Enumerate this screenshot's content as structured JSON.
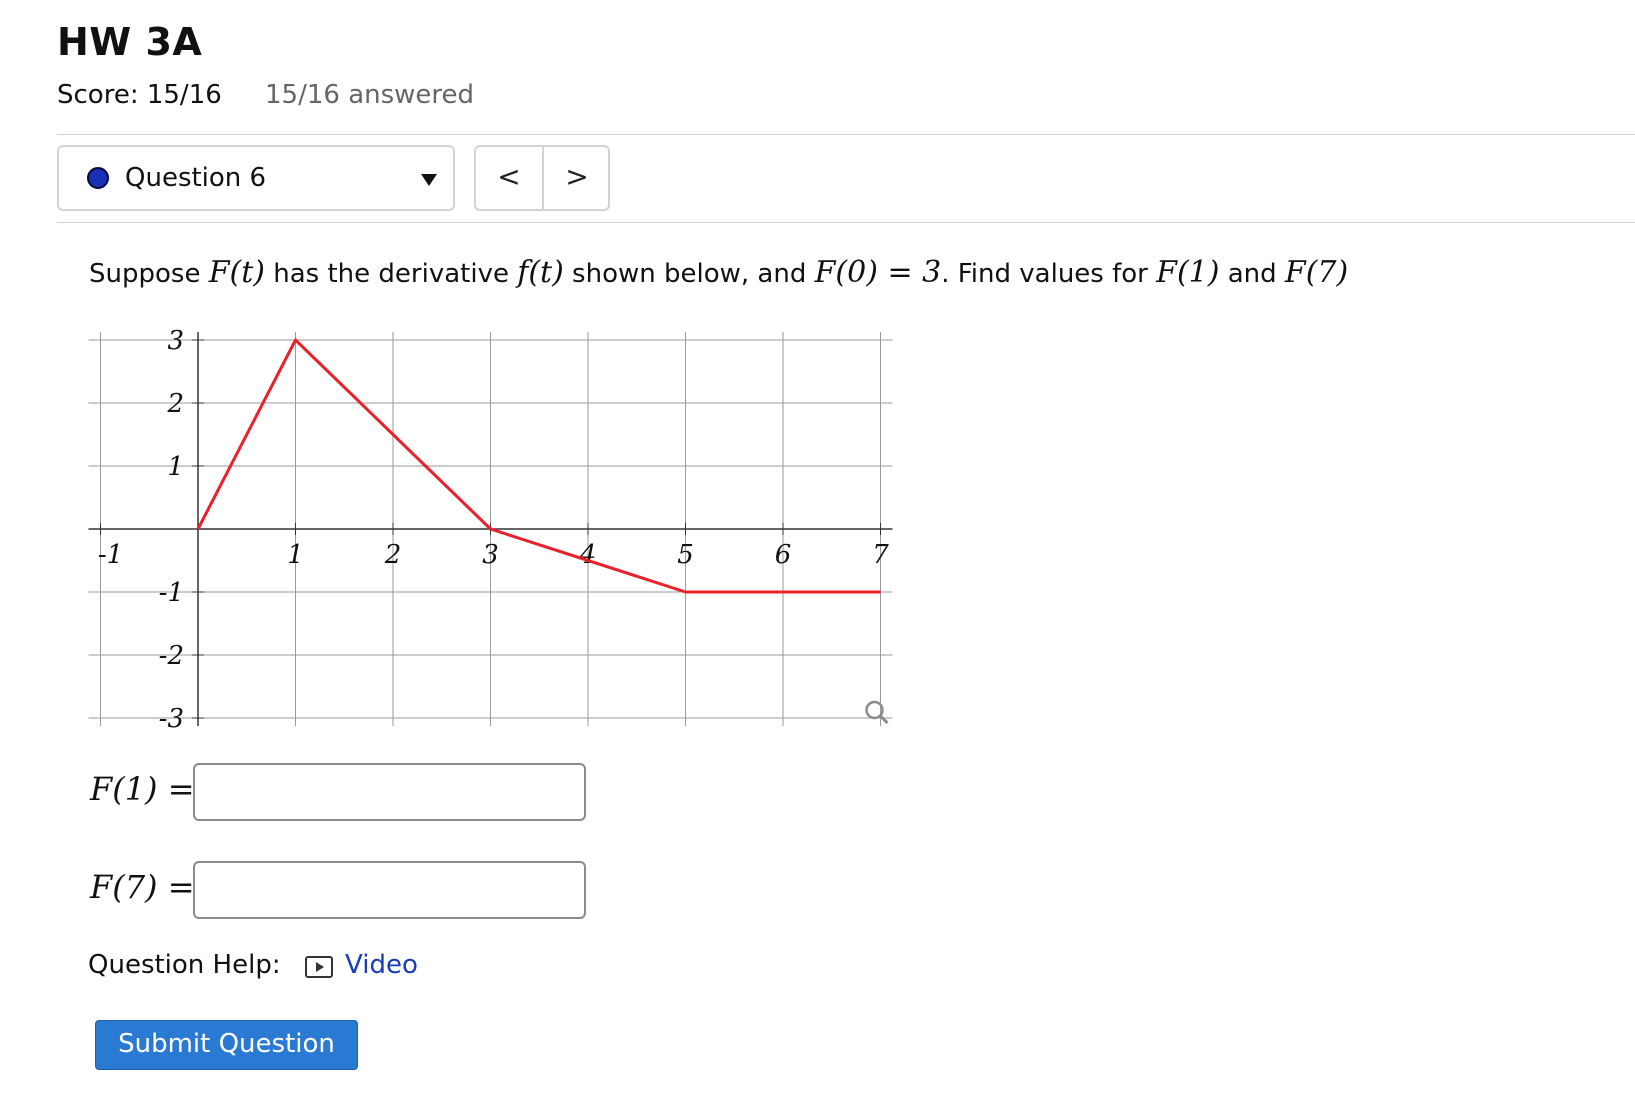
{
  "header": {
    "title": "HW 3A",
    "score": "Score: 15/16",
    "answered": "15/16 answered"
  },
  "question_nav": {
    "selected": "Question 6",
    "prev_label": "<",
    "next_label": ">"
  },
  "prompt": {
    "p1": "Suppose ",
    "m1": "F(t)",
    "p2": " has the derivative ",
    "m2": "f(t)",
    "p3": " shown below, and ",
    "m3": "F(0) = 3",
    "p4": ". Find values for ",
    "m4": "F(1)",
    "p5": " and ",
    "m5": "F(7)"
  },
  "chart_data": {
    "type": "line",
    "x": [
      0,
      1,
      3,
      5,
      7
    ],
    "y": [
      0,
      3,
      0,
      -1,
      -1
    ],
    "xlim": [
      -1,
      7
    ],
    "ylim": [
      -3,
      3
    ],
    "xticks": [
      "-1",
      "1",
      "2",
      "3",
      "4",
      "5",
      "6",
      "7"
    ],
    "yticks": [
      "3",
      "2",
      "1",
      "-1",
      "-2",
      "-3"
    ],
    "grid": true,
    "line_color": "#e8212b"
  },
  "answers": [
    {
      "label": "F(1) =",
      "value": ""
    },
    {
      "label": "F(7) =",
      "value": ""
    }
  ],
  "help": {
    "label": "Question Help:",
    "video_label": "Video"
  },
  "submit_label": "Submit Question"
}
